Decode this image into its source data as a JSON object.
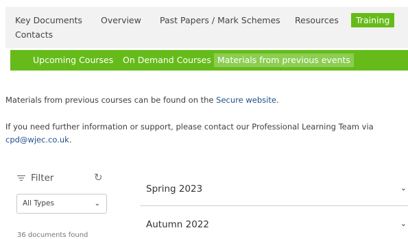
{
  "topnav": {
    "items": [
      {
        "label": "Key Documents"
      },
      {
        "label": "Overview"
      },
      {
        "label": "Past Papers / Mark Schemes"
      },
      {
        "label": "Resources"
      },
      {
        "label": "Training"
      },
      {
        "label": "Contacts"
      }
    ],
    "active_color": "#66bb1a"
  },
  "subnav": {
    "tabs": [
      {
        "label": "Upcoming Courses"
      },
      {
        "label": "On Demand Courses"
      },
      {
        "label": "Materials from previous events"
      }
    ],
    "active_tab": "Materials from previous events"
  },
  "content": {
    "p1_before": "Materials from previous courses can be found on the ",
    "p1_link": "Secure website",
    "p1_after": ".",
    "p2_text": "If you need further information or support, please contact our Professional Learning Team via",
    "p2_link": "cpd@wjec.co.uk",
    "p2_after": "."
  },
  "filter": {
    "title": "Filter",
    "type_value": "All Types",
    "docs_found": "36 documents found"
  },
  "accordion": [
    {
      "label": "Spring 2023"
    },
    {
      "label": "Autumn 2022"
    }
  ]
}
